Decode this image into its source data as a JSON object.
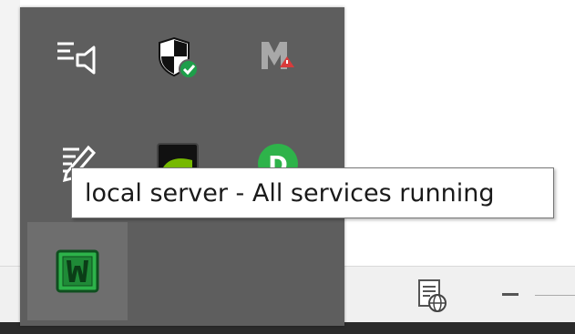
{
  "tray_icons": [
    {
      "name": "volume-mixer-icon"
    },
    {
      "name": "windows-security-icon"
    },
    {
      "name": "malwarebytes-icon"
    },
    {
      "name": "pen-settings-icon"
    },
    {
      "name": "nvidia-icon"
    },
    {
      "name": "green-app-icon"
    },
    {
      "name": "local-server-icon"
    }
  ],
  "tooltip": {
    "text": "local server - All services running"
  },
  "colors": {
    "tray_background": "#5e5e5e",
    "tray_hover": "#6e6e6e",
    "security_green": "#1e9e4a",
    "alert_red": "#d83b3b",
    "server_icon_green": "#2db34a",
    "app_green": "#2eb34a"
  }
}
